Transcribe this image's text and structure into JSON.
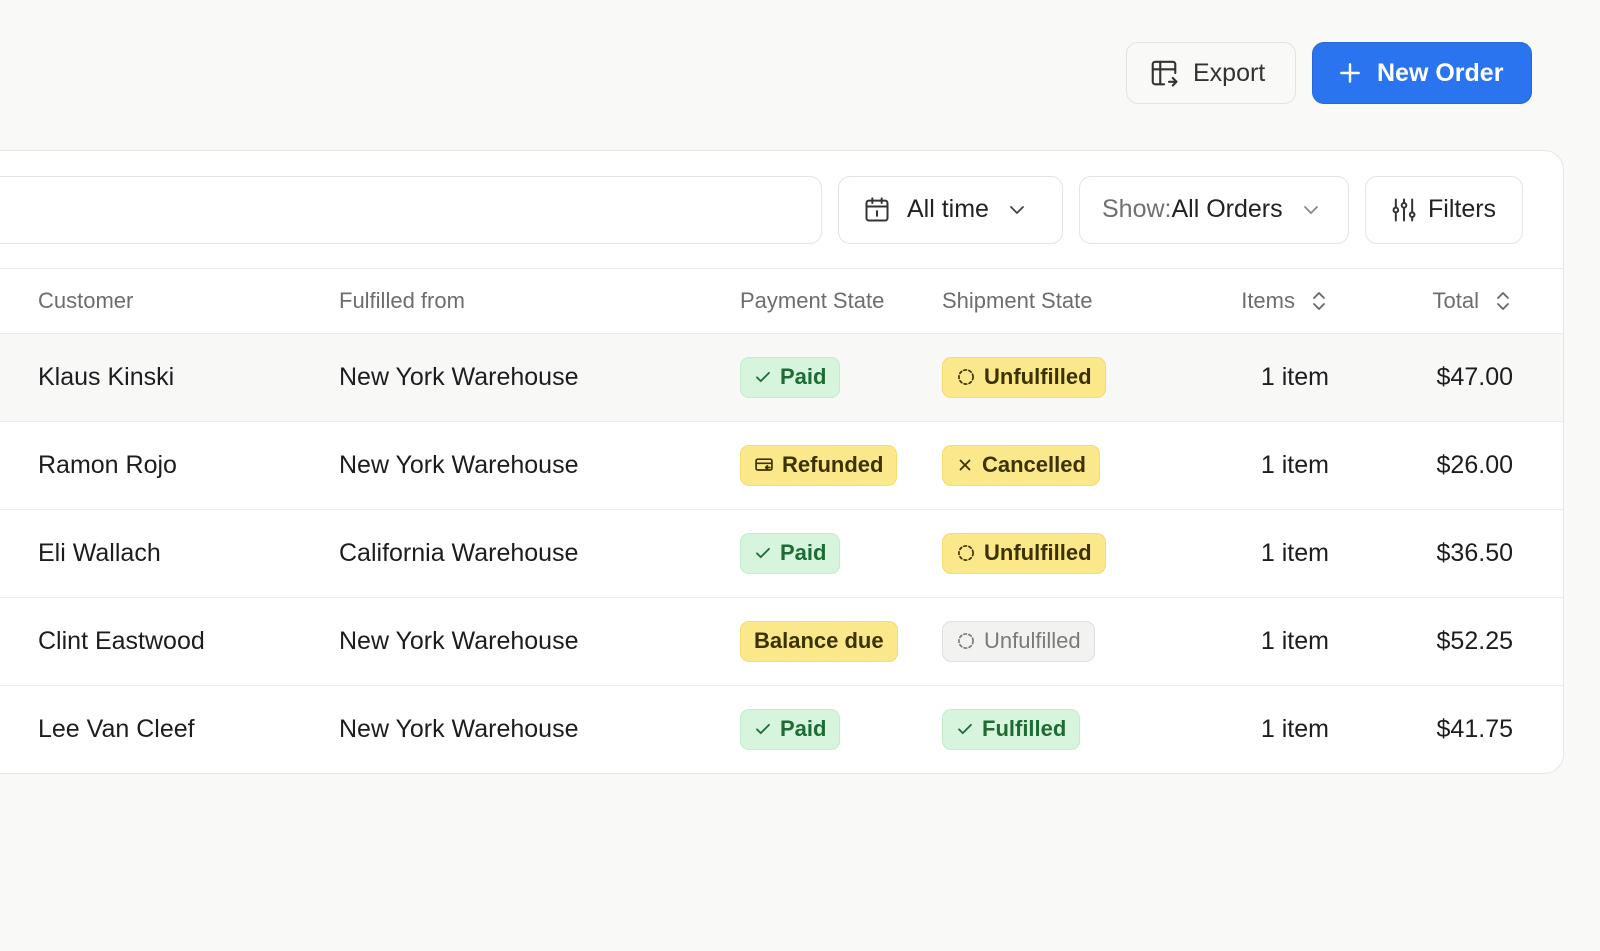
{
  "header": {
    "export_label": "Export",
    "new_order_label": "New Order"
  },
  "toolbar": {
    "search_value": "",
    "time_filter": "All time",
    "show_prefix": "Show:",
    "show_value": "All Orders",
    "filters_label": "Filters"
  },
  "table": {
    "columns": {
      "customer": "Customer",
      "fulfilled_from": "Fulfilled from",
      "payment_state": "Payment State",
      "shipment_state": "Shipment State",
      "items": "Items",
      "total": "Total"
    },
    "rows": [
      {
        "customer": "Klaus Kinski",
        "fulfilled_from": "New York Warehouse",
        "payment": "Paid",
        "payment_style": "green",
        "payment_icon": "check-icon",
        "shipment": "Unfulfilled",
        "shipment_style": "yellow",
        "shipment_icon": "dashed-circle-icon",
        "items": "1 item",
        "total": "$47.00"
      },
      {
        "customer": "Ramon Rojo",
        "fulfilled_from": "New York Warehouse",
        "payment": "Refunded",
        "payment_style": "yellow",
        "payment_icon": "refund-card-icon",
        "shipment": "Cancelled",
        "shipment_style": "yellow",
        "shipment_icon": "x-icon",
        "items": "1 item",
        "total": "$26.00"
      },
      {
        "customer": "Eli Wallach",
        "fulfilled_from": "California Warehouse",
        "payment": "Paid",
        "payment_style": "green",
        "payment_icon": "check-icon",
        "shipment": "Unfulfilled",
        "shipment_style": "yellow",
        "shipment_icon": "dashed-circle-icon",
        "items": "1 item",
        "total": "$36.50"
      },
      {
        "customer": "Clint Eastwood",
        "fulfilled_from": "New York Warehouse",
        "payment": "Balance due",
        "payment_style": "yellow",
        "payment_icon": "",
        "shipment": "Unfulfilled",
        "shipment_style": "gray",
        "shipment_icon": "dashed-circle-icon",
        "items": "1 item",
        "total": "$52.25"
      },
      {
        "customer": "Lee Van Cleef",
        "fulfilled_from": "New York Warehouse",
        "payment": "Paid",
        "payment_style": "green",
        "payment_icon": "check-icon",
        "shipment": "Fulfilled",
        "shipment_style": "green",
        "shipment_icon": "check-icon",
        "items": "1 item",
        "total": "$41.75"
      }
    ]
  },
  "colors": {
    "accent": "#2a74f0",
    "badge_green_bg": "#d6f5dc",
    "badge_yellow_bg": "#fbe88a",
    "badge_gray_bg": "#f2f2f1"
  }
}
